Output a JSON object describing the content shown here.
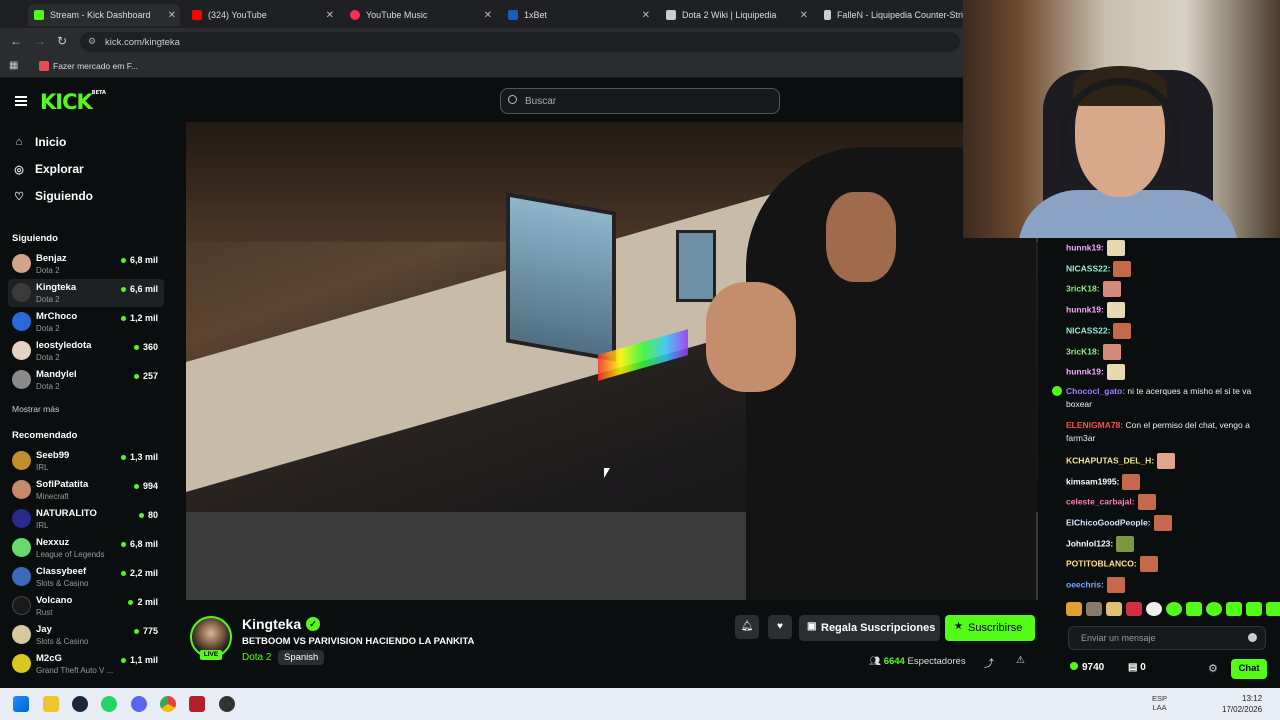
{
  "browser": {
    "tabs": [
      {
        "label": "Stream - Kick Dashboard",
        "color": "#53fc18"
      },
      {
        "label": "(324) YouTube",
        "color": "#ff0000"
      },
      {
        "label": "YouTube Music",
        "color": "#ff2d55"
      },
      {
        "label": "1xBet",
        "color": "#1a5fb4"
      },
      {
        "label": "Dota 2 Wiki | Liquipedia",
        "color": "#cccccc"
      },
      {
        "label": "FalleN - Liquipedia Counter-Stri",
        "color": "#cccccc"
      }
    ],
    "url": "kick.com/kingteka",
    "bookmark": "Fazer mercado em F..."
  },
  "header": {
    "logo": "KICK",
    "logo_badge": "BETA",
    "search_placeholder": "Buscar"
  },
  "sidebar": {
    "nav": [
      {
        "label": "Inicio",
        "icon": "home-icon"
      },
      {
        "label": "Explorar",
        "icon": "compass-icon"
      },
      {
        "label": "Siguiendo",
        "icon": "heart-icon"
      }
    ],
    "following_title": "Siguiendo",
    "following": [
      {
        "name": "Benjaz",
        "category": "Dota 2",
        "viewers": "6,8 mil"
      },
      {
        "name": "Kingteka",
        "category": "Dota 2",
        "viewers": "6,6 mil"
      },
      {
        "name": "MrChoco",
        "category": "Dota 2",
        "viewers": "1,2 mil"
      },
      {
        "name": "leostyledota",
        "category": "Dota 2",
        "viewers": "360"
      },
      {
        "name": "Mandylel",
        "category": "Dota 2",
        "viewers": "257"
      }
    ],
    "show_more": "Mostrar más",
    "recommended_title": "Recomendado",
    "recommended": [
      {
        "name": "Seeb99",
        "category": "IRL",
        "viewers": "1,3 mil"
      },
      {
        "name": "SofiPatatita",
        "category": "Minecraft",
        "viewers": "994"
      },
      {
        "name": "NATURALITO",
        "category": "IRL",
        "viewers": "80"
      },
      {
        "name": "Nexxuz",
        "category": "League of Legends",
        "viewers": "6,8 mil"
      },
      {
        "name": "Classybeef",
        "category": "Slots & Casino",
        "viewers": "2,2 mil"
      },
      {
        "name": "Volcano",
        "category": "Rust",
        "viewers": "2 mil"
      },
      {
        "name": "Jay",
        "category": "Slots & Casino",
        "viewers": "775"
      },
      {
        "name": "M2cG",
        "category": "Grand Theft Auto V ...",
        "viewers": "1,1 mil"
      }
    ]
  },
  "stream": {
    "streamer": "Kingteka",
    "live_badge": "LIVE",
    "title": "BETBOOM VS PARIVISION HACIENDO LA PANKITA",
    "category": "Dota 2",
    "language": "Spanish",
    "gift_button": "Regala Suscripciones",
    "subscribe_button": "Suscribirse",
    "viewers_count": "6644",
    "viewers_label": "Espectadores"
  },
  "chat": {
    "messages": [
      {
        "user": "hunnk19:",
        "text": "",
        "color": "#f5a8ff",
        "emote": "#e8d9b0"
      },
      {
        "user": "NICASS22:",
        "text": "",
        "color": "#9be8d0",
        "emote": "#c46a4a"
      },
      {
        "user": "3ricK18:",
        "text": "",
        "color": "#8cf07a",
        "emote": "#d48a7a"
      },
      {
        "user": "hunnk19:",
        "text": "",
        "color": "#f5a8ff",
        "emote": "#e8d9b0"
      },
      {
        "user": "NICASS22:",
        "text": "",
        "color": "#9be8d0",
        "emote": "#c46a4a"
      },
      {
        "user": "3ricK18:",
        "text": "",
        "color": "#8cf07a",
        "emote": "#d48a7a"
      },
      {
        "user": "hunnk19:",
        "text": "",
        "color": "#f5a8ff",
        "emote": "#e8d9b0"
      },
      {
        "user": "Chococl_gato:",
        "text": "ni te acerques a misho el si te va boxear",
        "color": "#9f7bff",
        "emote": ""
      },
      {
        "user": "ELENIGMA78:",
        "text": "Con el permiso del chat, vengo a farm3ar",
        "color": "#ff4b4b",
        "emote": ""
      },
      {
        "user": "KCHAPUTAS_DEL_H:",
        "text": "",
        "color": "#f0e68c",
        "emote": "#e3a48c"
      },
      {
        "user": "kimsam1995:",
        "text": "",
        "color": "#ffffff",
        "emote": "#c46a4a"
      },
      {
        "user": "celeste_carbajal:",
        "text": "",
        "color": "#ff7eb6",
        "emote": "#c46a4a"
      },
      {
        "user": "ElChicoGoodPeople:",
        "text": "",
        "color": "#d7e6ff",
        "emote": "#c46a4a"
      },
      {
        "user": "Johnlol123:",
        "text": "",
        "color": "#ffffff",
        "emote": "#7a9a40"
      },
      {
        "user": "POTITOBLANCO:",
        "text": "",
        "color": "#ffe27a",
        "emote": "#c46a4a"
      },
      {
        "user": "oeechris:",
        "text": "",
        "color": "#7aa7ff",
        "emote": "#c46a4a"
      }
    ],
    "input_placeholder": "Enviar un mensaje",
    "points": "9740",
    "gifts": "0",
    "send_button": "Chat"
  },
  "taskbar": {
    "lang": "ESP",
    "layout": "LAA",
    "time": "13:12",
    "date": "17/02/2026"
  }
}
